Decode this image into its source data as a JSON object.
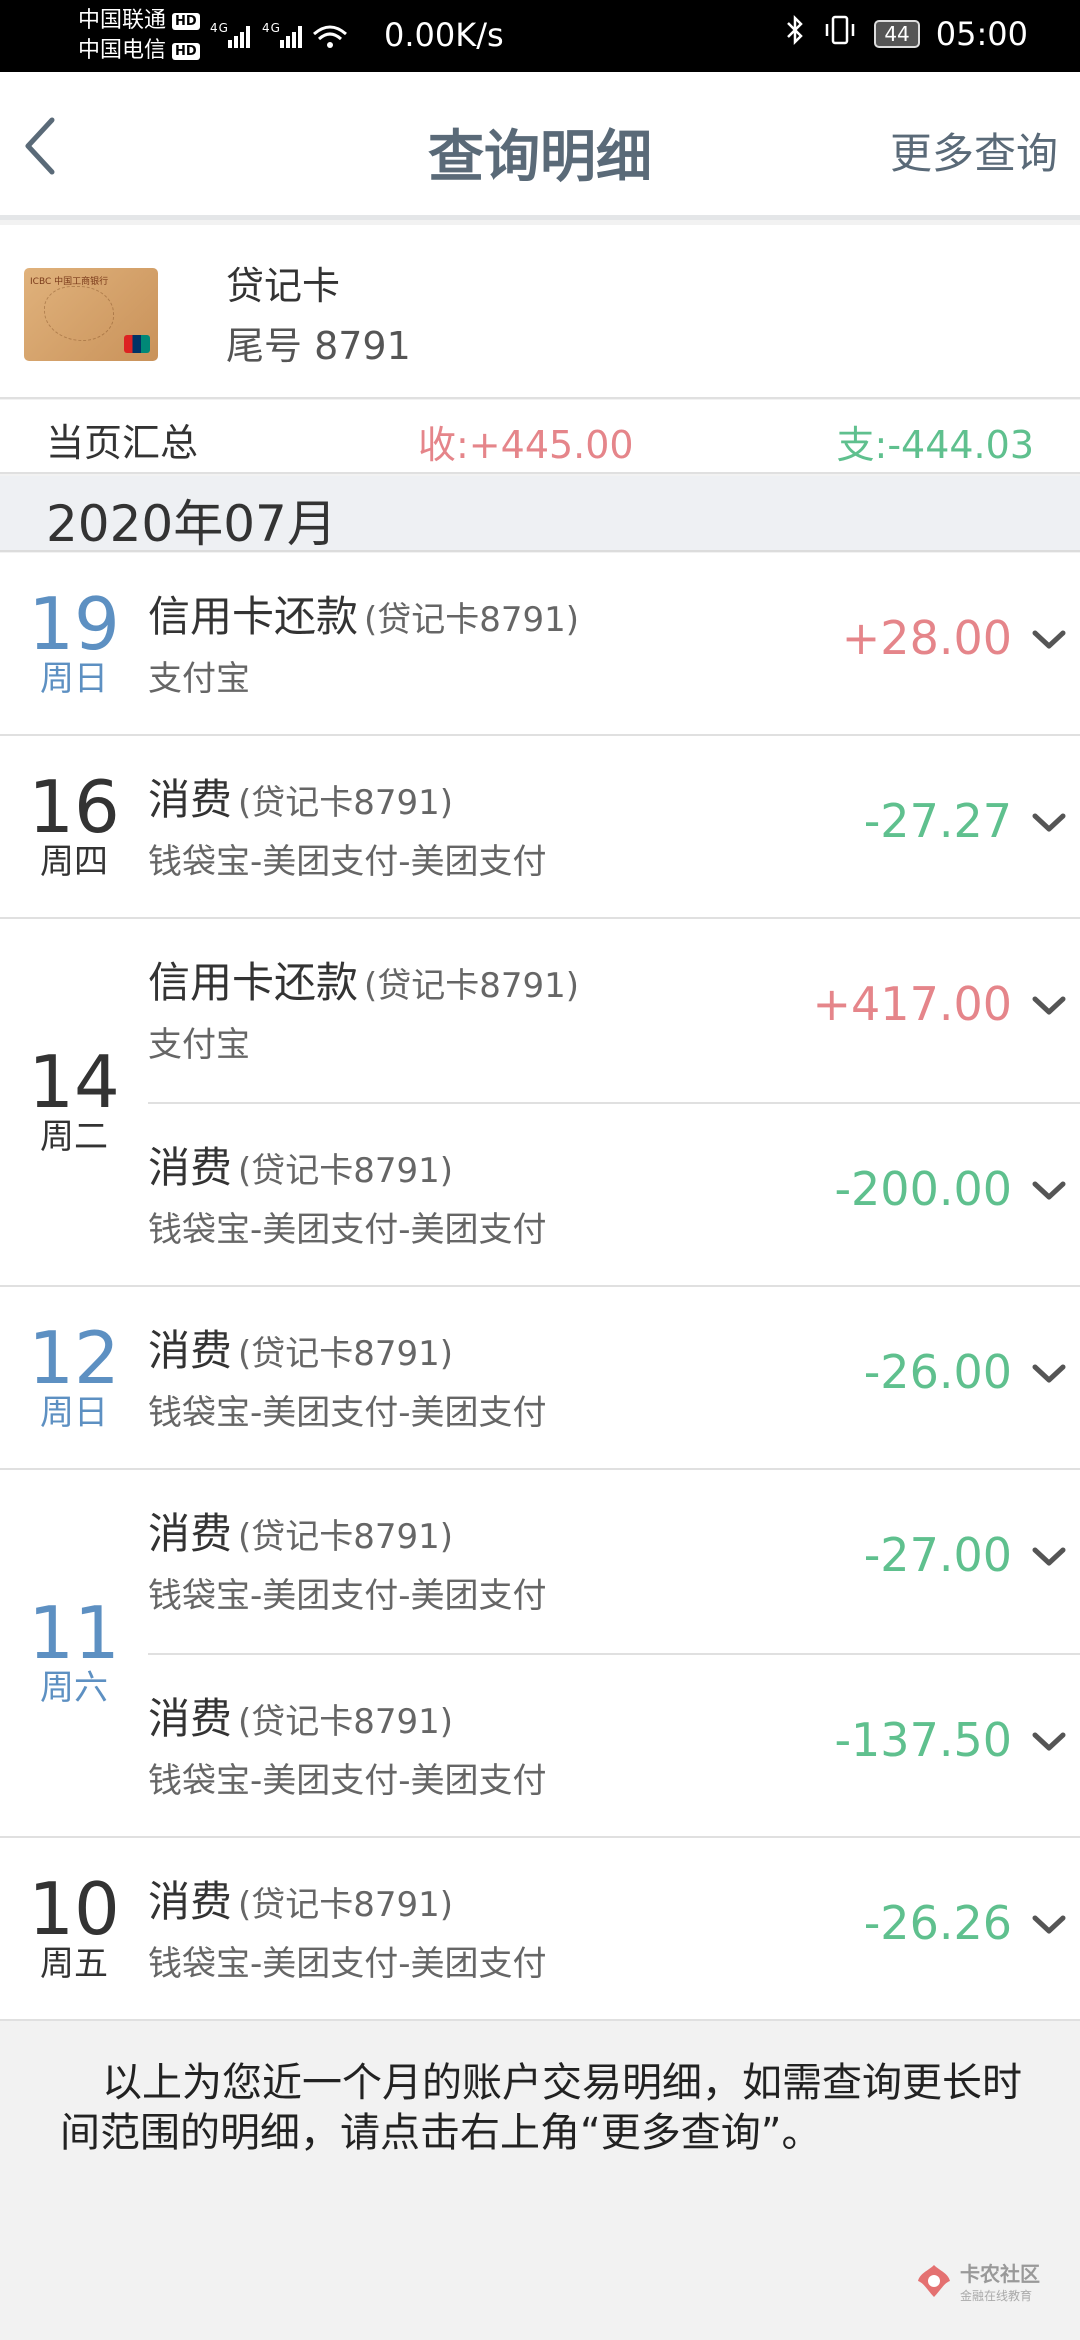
{
  "status_bar": {
    "carrier1": "中国联通",
    "carrier2": "中国电信",
    "hd": "HD",
    "net_speed": "0.00K/s",
    "battery": "44",
    "time": "05:00"
  },
  "nav": {
    "title": "查询明细",
    "more": "更多查询"
  },
  "card": {
    "type": "贷记卡",
    "tail": "尾号 8791"
  },
  "summary": {
    "label": "当页汇总",
    "income": "收:+445.00",
    "expense": "支:-444.03"
  },
  "month": "2020年07月",
  "groups": [
    {
      "day": "19",
      "weekday": "周日",
      "color": "#5d90c2",
      "txns": [
        {
          "title": "信用卡还款",
          "account": "(贷记卡8791)",
          "sub": "支付宝",
          "amount": "+28.00",
          "direction": "in"
        }
      ]
    },
    {
      "day": "16",
      "weekday": "周四",
      "color": "#333333",
      "txns": [
        {
          "title": "消费",
          "account": "(贷记卡8791)",
          "sub": "钱袋宝-美团支付-美团支付",
          "amount": "-27.27",
          "direction": "out"
        }
      ]
    },
    {
      "day": "14",
      "weekday": "周二",
      "color": "#333333",
      "txns": [
        {
          "title": "信用卡还款",
          "account": "(贷记卡8791)",
          "sub": "支付宝",
          "amount": "+417.00",
          "direction": "in"
        },
        {
          "title": "消费",
          "account": "(贷记卡8791)",
          "sub": "钱袋宝-美团支付-美团支付",
          "amount": "-200.00",
          "direction": "out"
        }
      ]
    },
    {
      "day": "12",
      "weekday": "周日",
      "color": "#5d90c2",
      "txns": [
        {
          "title": "消费",
          "account": "(贷记卡8791)",
          "sub": "钱袋宝-美团支付-美团支付",
          "amount": "-26.00",
          "direction": "out"
        }
      ]
    },
    {
      "day": "11",
      "weekday": "周六",
      "color": "#5d90c2",
      "txns": [
        {
          "title": "消费",
          "account": "(贷记卡8791)",
          "sub": "钱袋宝-美团支付-美团支付",
          "amount": "-27.00",
          "direction": "out"
        },
        {
          "title": "消费",
          "account": "(贷记卡8791)",
          "sub": "钱袋宝-美团支付-美团支付",
          "amount": "-137.50",
          "direction": "out"
        }
      ]
    },
    {
      "day": "10",
      "weekday": "周五",
      "color": "#333333",
      "txns": [
        {
          "title": "消费",
          "account": "(贷记卡8791)",
          "sub": "钱袋宝-美团支付-美团支付",
          "amount": "-26.26",
          "direction": "out"
        }
      ]
    }
  ],
  "footer_note": "以上为您近一个月的账户交易明细，如需查询更长时间范围的明细，请点击右上角“更多查询”。",
  "watermark": {
    "main": "卡农社区",
    "sub": "金融在线教育"
  },
  "colors": {
    "income": "#e5858a",
    "expense": "#5fc08e",
    "weekend_date": "#5d90c2",
    "nav_text": "#5a6a78"
  }
}
